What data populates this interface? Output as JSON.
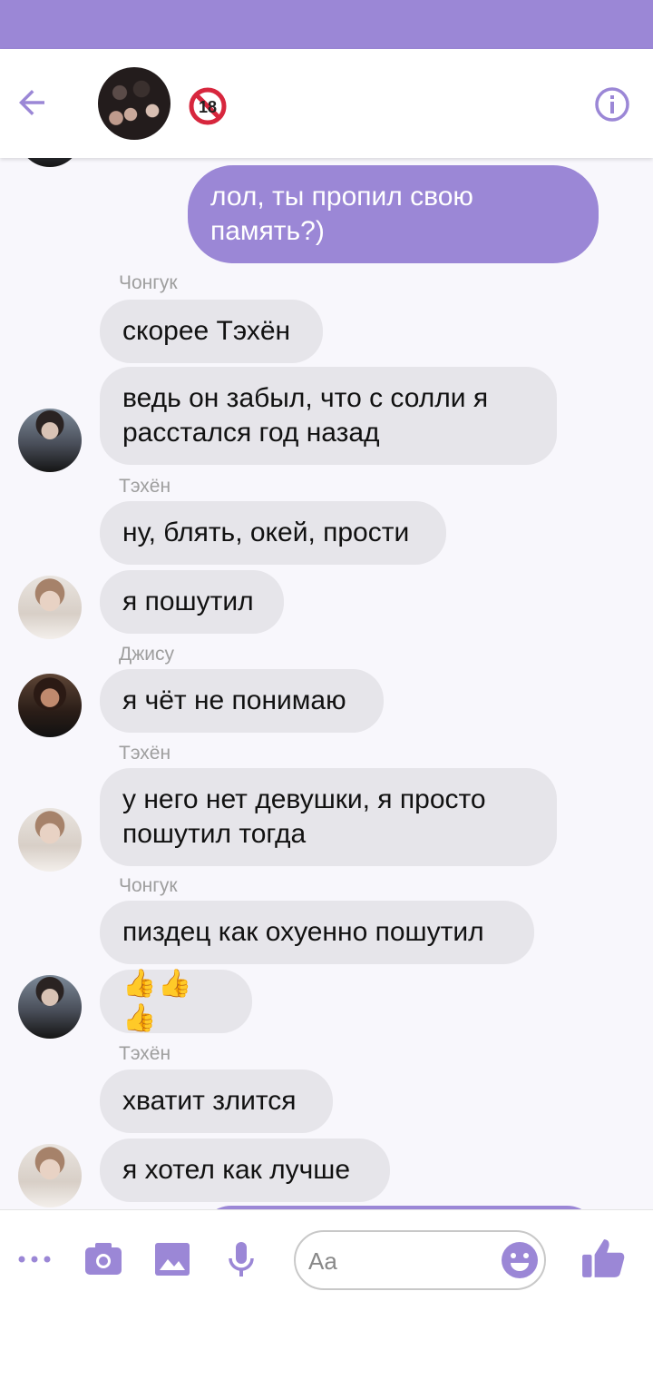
{
  "colors": {
    "accent": "#9b87d6",
    "incoming_bubble": "#e6e5ea",
    "sender_text": "#9e9e9e",
    "background": "#f8f7fc"
  },
  "header": {
    "title_emoji": "🔞"
  },
  "messages": [
    {
      "type": "out",
      "text": "лол, ты пропил свою память?)"
    },
    {
      "type": "sender",
      "text": "Чонгук"
    },
    {
      "type": "in",
      "text": "скорее Тэхён"
    },
    {
      "type": "in",
      "text": "ведь он забыл, что с солли я расстался год назад"
    },
    {
      "type": "sender",
      "text": "Тэхён"
    },
    {
      "type": "in",
      "text": "ну, блять, окей, прости"
    },
    {
      "type": "in",
      "text": "я пошутил"
    },
    {
      "type": "sender",
      "text": "Джису"
    },
    {
      "type": "in",
      "text": "я чёт не понимаю"
    },
    {
      "type": "sender",
      "text": "Тэхён"
    },
    {
      "type": "in",
      "text": "у него нет девушки, я просто пошутил тогда"
    },
    {
      "type": "sender",
      "text": "Чонгук"
    },
    {
      "type": "in",
      "text": "пиздец как охуенно пошутил"
    },
    {
      "type": "in",
      "text": "👍👍👍"
    },
    {
      "type": "sender",
      "text": "Тэхён"
    },
    {
      "type": "in",
      "text": "хватит злится"
    },
    {
      "type": "in",
      "text": "я хотел как лучше"
    }
  ],
  "composer": {
    "placeholder": "Aa"
  },
  "icons": [
    "back-arrow-icon",
    "info-icon",
    "more-icon",
    "camera-icon",
    "image-icon",
    "microphone-icon",
    "emoji-icon",
    "thumbs-up-icon"
  ]
}
